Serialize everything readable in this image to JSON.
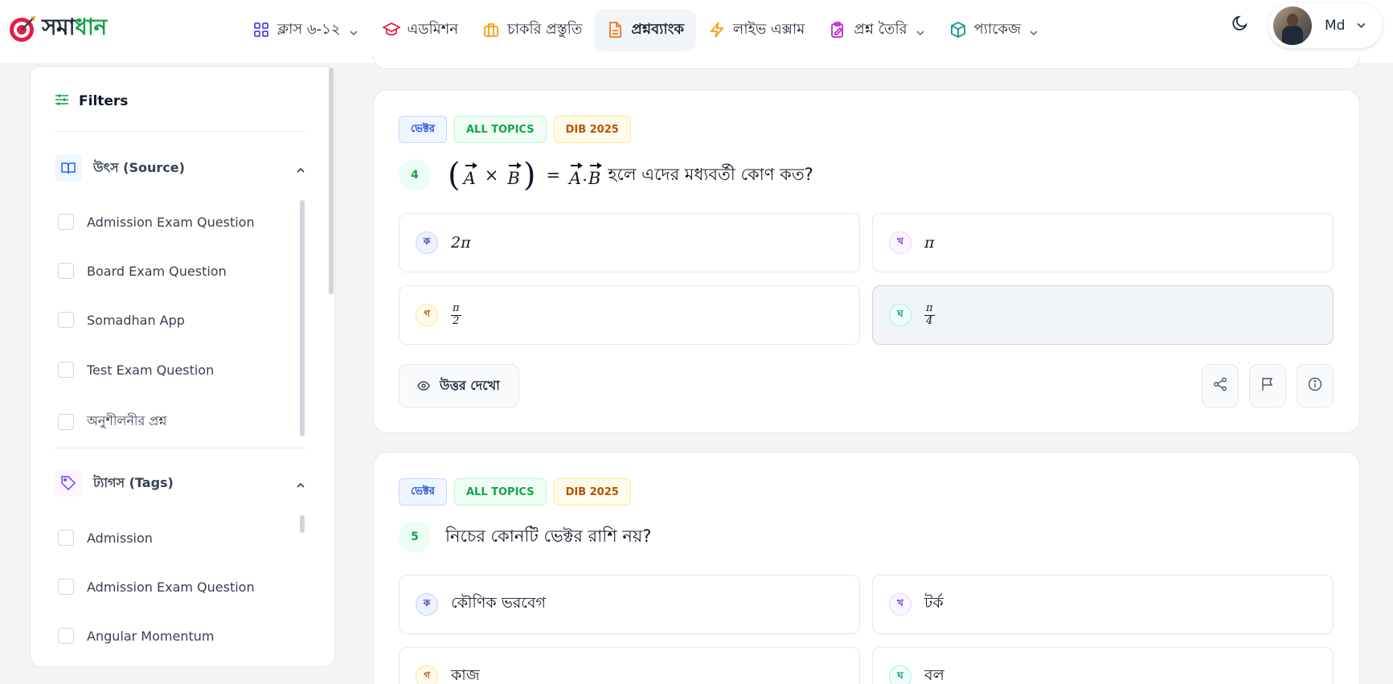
{
  "brand": {
    "part1": "সমা",
    "part2": "ধান"
  },
  "nav": [
    {
      "label": "ক্লাস ৬-১২",
      "icon": "grid-icon",
      "has_dropdown": true
    },
    {
      "label": "এডমিশন",
      "icon": "graduation-cap-icon",
      "has_dropdown": false
    },
    {
      "label": "চাকরি প্রস্তুতি",
      "icon": "briefcase-icon",
      "has_dropdown": false
    },
    {
      "label": "প্রশ্নব্যাংক",
      "icon": "document-icon",
      "has_dropdown": false,
      "active": true
    },
    {
      "label": "লাইভ এক্সাম",
      "icon": "lightning-icon",
      "has_dropdown": false
    },
    {
      "label": "প্রশ্ন তৈরি",
      "icon": "clipboard-edit-icon",
      "has_dropdown": true
    },
    {
      "label": "প্যাকেজ",
      "icon": "package-icon",
      "has_dropdown": true
    }
  ],
  "user": {
    "name": "Md"
  },
  "sidebar": {
    "title": "Filters",
    "source": {
      "title": "উৎস (Source)",
      "options": [
        "Admission Exam Question",
        "Board Exam Question",
        "Somadhan App",
        "Test Exam Question",
        "অনুশীলনীর প্রশ্ন"
      ]
    },
    "tags": {
      "title": "ট্যাগস (Tags)",
      "options": [
        "Admission",
        "Admission Exam Question",
        "Angular Momentum"
      ]
    }
  },
  "questions": [
    {
      "number": "4",
      "badges": [
        "ভেক্টর",
        "ALL TOPICS",
        "DIB 2025"
      ],
      "text_suffix": "হলে এদের মধ্যবর্তী কোণ কত?",
      "math": {
        "a": "A",
        "b": "B",
        "times": "×",
        "eq": "=",
        "dot": "."
      },
      "options": [
        {
          "letter": "ক",
          "value": "2π"
        },
        {
          "letter": "খ",
          "value": "π"
        },
        {
          "letter": "গ",
          "num": "π",
          "den": "2"
        },
        {
          "letter": "ঘ",
          "num": "π",
          "den": "4",
          "selected": true
        }
      ],
      "answer_button": "উত্তর দেখো"
    },
    {
      "number": "5",
      "badges": [
        "ভেক্টর",
        "ALL TOPICS",
        "DIB 2025"
      ],
      "text": "নিচের কোনটি ভেক্টর রাশি নয়?",
      "options": [
        {
          "letter": "ক",
          "value": "কৌণিক ভরবেগ"
        },
        {
          "letter": "খ",
          "value": "টর্ক"
        },
        {
          "letter": "গ",
          "value": "কাজ"
        },
        {
          "letter": "ঘ",
          "value": "বল"
        }
      ]
    }
  ],
  "colors": {
    "brand_green": "#16a34a",
    "active_nav_bg": "#f1f5f9"
  }
}
